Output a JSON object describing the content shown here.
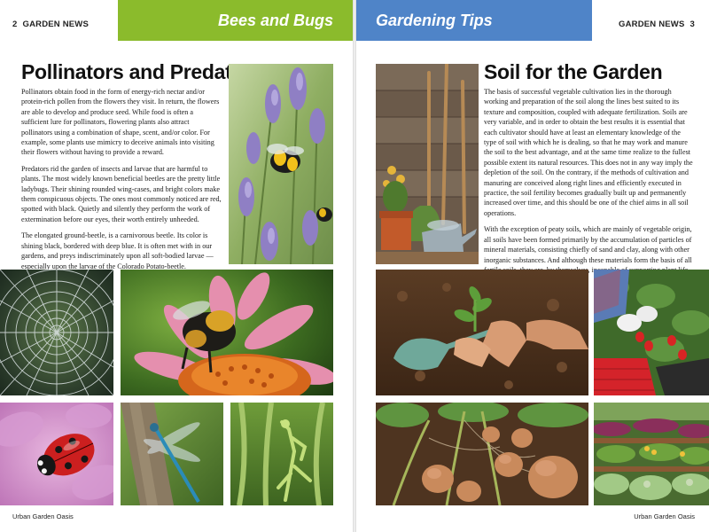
{
  "left_page": {
    "page_number": "2",
    "running_head": "GARDEN NEWS",
    "section_tab": "Bees and Bugs",
    "article": {
      "title": "Pollinators and Predators",
      "paragraphs": [
        "Pollinators obtain food in the form of energy-rich nectar and/or protein-rich pollen from the flowers they visit. In return, the flowers are able to develop and produce seed. While food is often a sufficient lure for pollinators, flowering plants also attract pollinators using a combination of shape, scent, and/or color. For example, some plants use mimicry to deceive animals into visiting their flowers without having to provide a reward.",
        "Predators rid the garden of insects and larvae that are harmful to plants. The most widely known beneficial beetles are the pretty little ladybugs. Their shining rounded wing-cases, and bright colors make them conspicuous objects. The ones most commonly noticed are red, spotted with black. Quietly and silently they perform the work of extermination before our eyes, their worth entirely unheeded.",
        "The elongated ground-beetle, is a carnivorous beetle. Its color is shining black, bordered with deep blue. It is often met with in our gardens, and preys indiscriminately upon all soft-bodied larvae — especially upon the larvae of the Colorado Potato-beetle."
      ]
    },
    "footer": "Urban Garden Oasis"
  },
  "right_page": {
    "page_number": "3",
    "running_head": "GARDEN NEWS",
    "section_tab": "Gardening Tips",
    "article": {
      "title": "Soil for the Garden",
      "paragraphs": [
        "The basis of successful vegetable cultivation lies in the thorough working and preparation of the soil along the lines best suited to its texture and composition, coupled with adequate fertilization. Soils are very variable, and in order to obtain the best results it is essential that each cultivator should have at least an elementary knowledge of the type of soil with which he is dealing, so that he may work and manure the soil to the best advantage, and at the same time realize to the fullest possible extent its natural resources. This does not in any way imply the depletion of the soil. On the contrary, if the methods of cultivation and manuring are conceived along right lines and efficiently executed in practice, the soil fertility becomes gradually built up and permanently increased over time, and this should be one of the chief aims in all soil operations.",
        "With the exception of peaty soils, which are mainly of vegetable origin, all soils have been formed primarily by the accumulation of particles of mineral materials, consisting chiefly of sand and clay, along with other inorganic substances. And although these materials form the basis of all fertile soils, they are, by themselves, incapable of supporting plant life."
      ]
    },
    "footer": "Urban Garden Oasis"
  },
  "colors": {
    "tab_green": "#8bbb2c",
    "tab_blue": "#4f84c8"
  }
}
